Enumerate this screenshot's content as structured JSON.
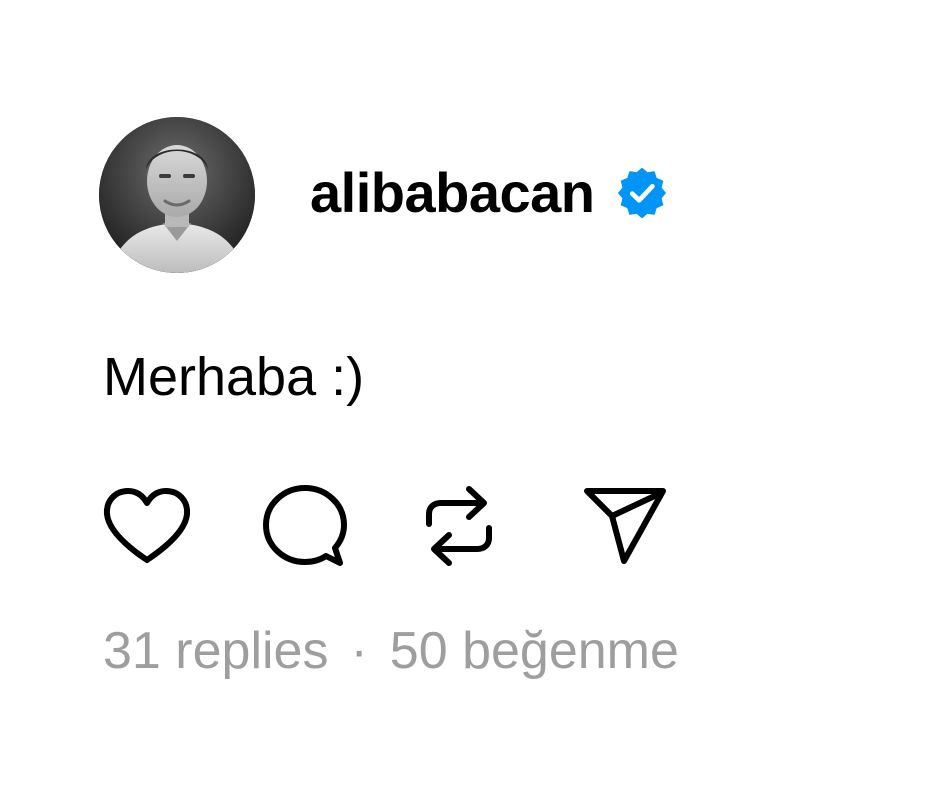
{
  "post": {
    "username": "alibabacan",
    "verified": true,
    "text": "Merhaba :)",
    "replies_label": "31 replies",
    "separator": "·",
    "likes_label": "50 beğenme"
  },
  "actions": [
    {
      "name": "like",
      "icon": "heart-icon"
    },
    {
      "name": "reply",
      "icon": "comment-icon"
    },
    {
      "name": "repost",
      "icon": "repost-icon"
    },
    {
      "name": "share",
      "icon": "send-icon"
    }
  ],
  "colors": {
    "verified_badge": "#0095f6",
    "meta_text": "#9e9e9e",
    "icon_stroke": "#000000"
  }
}
